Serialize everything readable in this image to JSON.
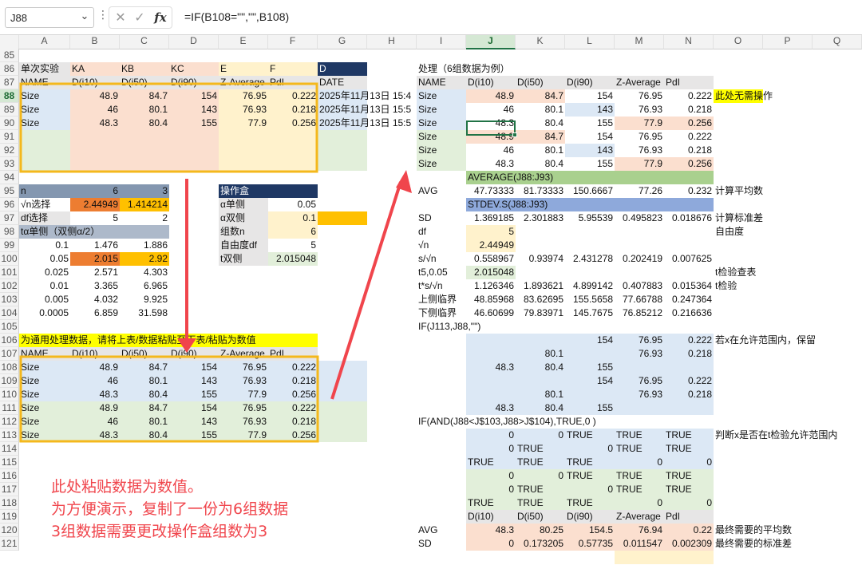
{
  "formula_bar": {
    "name_box": "J88",
    "formula": "=IF(B108=\"\",\"\",B108)",
    "fx_label": "fx"
  },
  "columns": [
    "A",
    "B",
    "C",
    "D",
    "E",
    "F",
    "G",
    "H",
    "I",
    "J",
    "K",
    "L",
    "M",
    "N",
    "O",
    "P",
    "Q"
  ],
  "selected_column": "J",
  "rows": [
    "85",
    "86",
    "87",
    "88",
    "89",
    "90",
    "91",
    "92",
    "93",
    "94",
    "95",
    "96",
    "97",
    "98",
    "99",
    "100",
    "101",
    "102",
    "103",
    "104",
    "105",
    "106",
    "107",
    "108",
    "109",
    "110",
    "111",
    "112",
    "113",
    "114",
    "115",
    "116",
    "117",
    "118",
    "119",
    "120",
    "121"
  ],
  "selected_row": "88",
  "annotation_lines": [
    "此处粘贴数据为数值。",
    "为方便演示，复制了一份为6组数据",
    "3组数据需要更改操作盒组数为3"
  ],
  "cells": {
    "A86": "单次实验",
    "B86": "KA",
    "C86": "KB",
    "D86": "KC",
    "E86": "E",
    "F86": "F",
    "G86": "D",
    "I86": "处理（6组数据为例）",
    "A87": "NAME",
    "B87": "D(i10)",
    "C87": "D(i50)",
    "D87": "D(i90)",
    "E87": "Z-Average",
    "F87": "PdI",
    "G87": "DATE",
    "I87": "NAME",
    "J87": "D(i10)",
    "K87": "D(i50)",
    "L87": "D(i90)",
    "M87": "Z-Average",
    "N87": "PdI",
    "A88": "Size",
    "B88": "48.9",
    "C88": "84.7",
    "D88": "154",
    "E88": "76.95",
    "F88": "0.222",
    "G88": "2025年11月13日 15:4",
    "I88": "Size",
    "J88": "48.9",
    "K88": "84.7",
    "L88": "154",
    "M88": "76.95",
    "N88": "0.222",
    "O88": "此处无需操作",
    "A89": "Size",
    "B89": "46",
    "C89": "80.1",
    "D89": "143",
    "E89": "76.93",
    "F89": "0.218",
    "G89": "2025年11月13日 15:5",
    "I89": "Size",
    "J89": "46",
    "K89": "80.1",
    "L89": "143",
    "M89": "76.93",
    "N89": "0.218",
    "A90": "Size",
    "B90": "48.3",
    "C90": "80.4",
    "D90": "155",
    "E90": "77.9",
    "F90": "0.256",
    "G90": "2025年11月13日 15:5",
    "I90": "Size",
    "J90": "48.3",
    "K90": "80.4",
    "L90": "155",
    "M90": "77.9",
    "N90": "0.256",
    "I91": "Size",
    "J91": "48.9",
    "K91": "84.7",
    "L91": "154",
    "M91": "76.95",
    "N91": "0.222",
    "I92": "Size",
    "J92": "46",
    "K92": "80.1",
    "L92": "143",
    "M92": "76.93",
    "N92": "0.218",
    "I93": "Size",
    "J93": "48.3",
    "K93": "80.4",
    "L93": "155",
    "M93": "77.9",
    "N93": "0.256",
    "J94": "AVERAGE(J88:J93)",
    "A95": "n",
    "B95": "6",
    "C95": "3",
    "E95": "操作盒",
    "I95": "AVG",
    "J95": "47.73333",
    "K95": "81.73333",
    "L95": "150.6667",
    "M95": "77.26",
    "N95": "0.232",
    "O95": "计算平均数",
    "A96": "√n选择",
    "B96": "2.44949",
    "C96": "1.414214",
    "E96": "α单侧",
    "F96": "0.05",
    "J96": "STDEV.S(J88:J93)",
    "A97": "df选择",
    "B97": "5",
    "C97": "2",
    "E97": "α双侧",
    "F97": "0.1",
    "I97": "SD",
    "J97": "1.369185",
    "K97": "2.301883",
    "L97": "5.95539",
    "M97": "0.495823",
    "N97": "0.018676",
    "O97": "计算标准差",
    "A98": "tα单侧（双侧α/2）",
    "E98": "组数n",
    "F98": "6",
    "I98": "df",
    "J98": "5",
    "O98": "自由度",
    "A99": "0.1",
    "B99": "1.476",
    "C99": "1.886",
    "E99": "自由度df",
    "F99": "5",
    "I99": "√n",
    "J99": "2.44949",
    "A100": "0.05",
    "B100": "2.015",
    "C100": "2.92",
    "E100": "t双侧",
    "F100": "2.015048",
    "I100": "s/√n",
    "J100": "0.558967",
    "K100": "0.93974",
    "L100": "2.431278",
    "M100": "0.202419",
    "N100": "0.007625",
    "A101": "0.025",
    "B101": "2.571",
    "C101": "4.303",
    "I101": "t5,0.05",
    "J101": "2.015048",
    "O101": "t检验查表",
    "A102": "0.01",
    "B102": "3.365",
    "C102": "6.965",
    "I102": "t*s/√n",
    "J102": "1.126346",
    "K102": "1.893621",
    "L102": "4.899142",
    "M102": "0.407883",
    "N102": "0.015364",
    "O102": "t检验",
    "A103": "0.005",
    "B103": "4.032",
    "C103": "9.925",
    "I103": "上侧临界",
    "J103": "48.85968",
    "K103": "83.62695",
    "L103": "155.5658",
    "M103": "77.66788",
    "N103": "0.247364",
    "A104": "0.0005",
    "B104": "6.859",
    "C104": "31.598",
    "I104": "下侧临界",
    "J104": "46.60699",
    "K104": "79.83971",
    "L104": "145.7675",
    "M104": "76.85212",
    "N104": "0.216636",
    "I105": "IF(J113,J88,\"\")",
    "A106": "为通用处理数据，请将上表/数据粘贴至下表/粘贴为数值",
    "L106": "154",
    "M106": "76.95",
    "N106": "0.222",
    "O106": "若x在允许范围内，保留",
    "A107": "NAME",
    "B107": "D(i10)",
    "C107": "D(i50)",
    "D107": "D(i90)",
    "E107": "Z-Average",
    "F107": "PdI",
    "K107": "80.1",
    "M107": "76.93",
    "N107": "0.218",
    "A108": "Size",
    "B108": "48.9",
    "C108": "84.7",
    "D108": "154",
    "E108": "76.95",
    "F108": "0.222",
    "J108": "48.3",
    "K108": "80.4",
    "L108": "155",
    "A109": "Size",
    "B109": "46",
    "C109": "80.1",
    "D109": "143",
    "E109": "76.93",
    "F109": "0.218",
    "L109": "154",
    "M109": "76.95",
    "N109": "0.222",
    "A110": "Size",
    "B110": "48.3",
    "C110": "80.4",
    "D110": "155",
    "E110": "77.9",
    "F110": "0.256",
    "K110": "80.1",
    "M110": "76.93",
    "N110": "0.218",
    "A111": "Size",
    "B111": "48.9",
    "C111": "84.7",
    "D111": "154",
    "E111": "76.95",
    "F111": "0.222",
    "J111": "48.3",
    "K111": "80.4",
    "L111": "155",
    "A112": "Size",
    "B112": "46",
    "C112": "80.1",
    "D112": "143",
    "E112": "76.93",
    "F112": "0.218",
    "I112": "IF(AND(J88<J$103,J88>J$104),TRUE,0 )",
    "A113": "Size",
    "B113": "48.3",
    "C113": "80.4",
    "D113": "155",
    "E113": "77.9",
    "F113": "0.256",
    "J113": "0",
    "K113": "0",
    "L113": "TRUE",
    "M113": "TRUE",
    "N113": "TRUE",
    "O113": "判断x是否在t检验允许范围内",
    "J114": "0",
    "K114": "TRUE",
    "L114": "0",
    "M114": "TRUE",
    "N114": "TRUE",
    "J115": "TRUE",
    "K115": "TRUE",
    "L115": "TRUE",
    "M115": "0",
    "N115": "0",
    "J116": "0",
    "K116": "0",
    "L116": "TRUE",
    "M116": "TRUE",
    "N116": "TRUE",
    "J117": "0",
    "K117": "TRUE",
    "L117": "0",
    "M117": "TRUE",
    "N117": "TRUE",
    "J118": "TRUE",
    "K118": "TRUE",
    "L118": "TRUE",
    "M118": "0",
    "N118": "0",
    "J119": "D(i10)",
    "K119": "D(i50)",
    "L119": "D(i90)",
    "M119": "Z-Average",
    "N119": "PdI",
    "I120": "AVG",
    "J120": "48.3",
    "K120": "80.25",
    "L120": "154.5",
    "M120": "76.94",
    "N120": "0.22",
    "O120": "最终需要的平均数",
    "I121": "SD",
    "J121": "0",
    "K121": "0.173205",
    "L121": "0.57735",
    "M121": "0.011547",
    "N121": "0.002309",
    "O121": "最终需要的标准差"
  }
}
